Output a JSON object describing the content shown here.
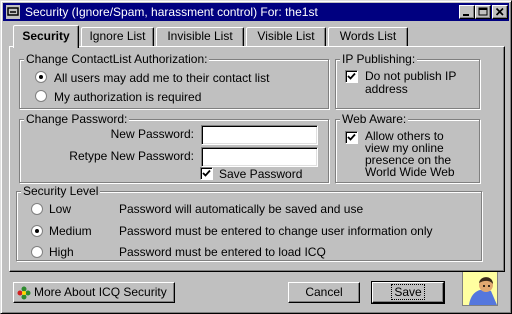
{
  "window": {
    "title": "Security (Ignore/Spam, harassment control) For: the1st",
    "buttons": {
      "minimize": "minimize-icon",
      "maximize": "maximize-icon",
      "close": "close-icon"
    }
  },
  "tabs": [
    {
      "label": "Security",
      "active": true
    },
    {
      "label": "Ignore List",
      "active": false
    },
    {
      "label": "Invisible List",
      "active": false
    },
    {
      "label": "Visible List",
      "active": false
    },
    {
      "label": "Words List",
      "active": false
    }
  ],
  "authorization": {
    "group_label": "Change ContactList Authorization:",
    "options": [
      {
        "label": "All users may add me to their contact list",
        "selected": true
      },
      {
        "label": "My authorization is required",
        "selected": false
      }
    ]
  },
  "ip_publishing": {
    "group_label": "IP Publishing:",
    "checkbox_line1": "Do not publish IP",
    "checkbox_line2": "address",
    "checked": true
  },
  "password": {
    "group_label": "Change Password:",
    "new_label": "New Password:",
    "retype_label": "Retype New Password:",
    "new_value": "",
    "retype_value": "",
    "save_label": "Save Password",
    "save_checked": true
  },
  "web_aware": {
    "group_label": "Web Aware:",
    "lines": [
      "Allow others to",
      "view my online",
      "presence on the",
      "World Wide Web"
    ],
    "checked": true
  },
  "security_level": {
    "group_label": "Security Level",
    "levels": [
      {
        "name": "Low",
        "description": "Password will automatically be saved and use",
        "selected": false
      },
      {
        "name": "Medium",
        "description": "Password must be entered to change user information only",
        "selected": true
      },
      {
        "name": "High",
        "description": "Password must be entered to load ICQ",
        "selected": false
      }
    ]
  },
  "footer": {
    "more_about_label": "More About ICQ Security",
    "cancel_label": "Cancel",
    "save_label": "Save"
  }
}
